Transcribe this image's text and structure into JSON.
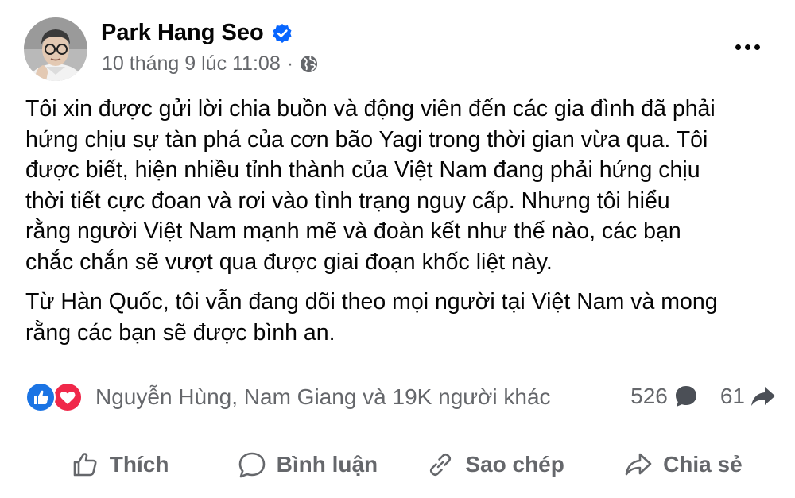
{
  "post": {
    "author": "Park Hang Seo",
    "verified": true,
    "timestamp": "10 tháng 9 lúc 11:08",
    "timestamp_separator": "·",
    "audience_icon": "globe-icon",
    "paragraphs": [
      [
        "Tôi xin được gửi lời chia buồn và động viên đến các gia đình đã phải",
        "hứng chịu sự tàn phá của cơn bão Yagi trong thời gian vừa qua. Tôi",
        "được biết, hiện nhiều tỉnh thành của Việt Nam đang phải hứng chịu",
        "thời tiết cực đoan và rơi vào tình trạng nguy cấp. Nhưng tôi hiểu",
        "rằng người Việt Nam mạnh mẽ và đoàn kết như thế nào, các bạn",
        "chắc chắn sẽ vượt qua được giai đoạn khốc liệt này."
      ],
      [
        "Từ Hàn Quốc, tôi vẫn đang dõi theo mọi người tại Việt Nam và mong",
        "rằng các bạn sẽ được bình an."
      ]
    ]
  },
  "reactions": {
    "icons": [
      "like-icon",
      "love-icon"
    ],
    "summary": "Nguyễn Hùng, Nam Giang và 19K người khác",
    "comment_count": "526",
    "share_count": "61"
  },
  "actions": {
    "like_label": "Thích",
    "comment_label": "Bình luận",
    "copy_label": "Sao chép",
    "share_label": "Chia sẻ"
  },
  "colors": {
    "text": "#050505",
    "secondary": "#65676b",
    "verified_blue": "#0866ff",
    "like_blue": "#1b74e4",
    "love_red": "#f0284a"
  }
}
